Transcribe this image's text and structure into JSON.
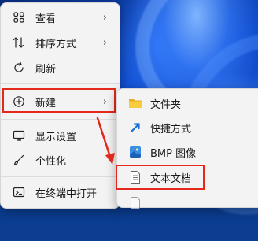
{
  "main_menu": {
    "items": [
      {
        "label": "查看",
        "icon": "grid-icon",
        "has_submenu": true
      },
      {
        "label": "排序方式",
        "icon": "sort-icon",
        "has_submenu": true
      },
      {
        "label": "刷新",
        "icon": "refresh-icon",
        "has_submenu": false
      },
      {
        "label": "新建",
        "icon": "plus-circle-icon",
        "has_submenu": true,
        "highlighted": true
      },
      {
        "label": "显示设置",
        "icon": "display-icon",
        "has_submenu": false
      },
      {
        "label": "个性化",
        "icon": "brush-icon",
        "has_submenu": false
      },
      {
        "label": "在终端中打开",
        "icon": "terminal-icon",
        "has_submenu": false
      }
    ]
  },
  "submenu": {
    "items": [
      {
        "label": "文件夹",
        "icon": "folder-icon"
      },
      {
        "label": "快捷方式",
        "icon": "shortcut-icon"
      },
      {
        "label": "BMP 图像",
        "icon": "image-icon"
      },
      {
        "label": "文本文档",
        "icon": "text-file-icon",
        "highlighted": true
      }
    ]
  },
  "colors": {
    "annotation_red": "#e4281c",
    "menu_bg": "#f3f3f3"
  }
}
